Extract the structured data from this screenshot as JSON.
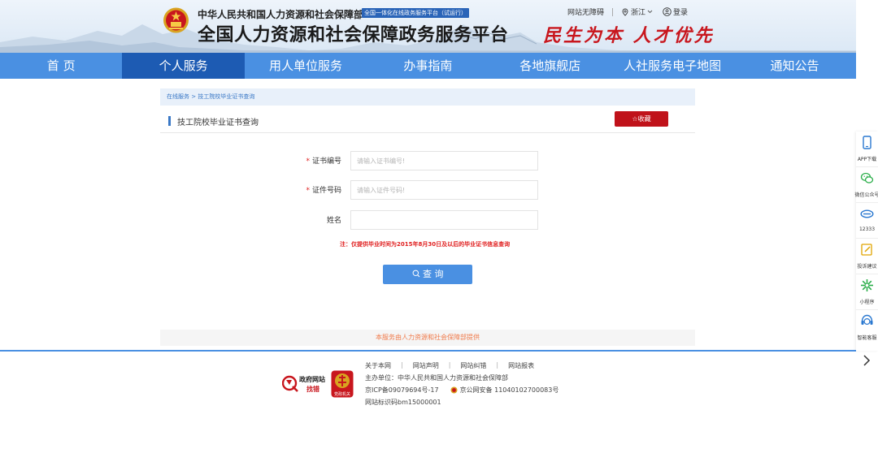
{
  "header": {
    "org_name": "中华人民共和国人力资源和社会保障部",
    "badge": "全国一体化在线政务服务平台（试运行）",
    "platform_title": "全国人力资源和社会保障政务服务平台",
    "slogan": "民生为本 人才优先",
    "accessibility_link": "网站无障碍",
    "location": "浙江",
    "login": "登录"
  },
  "nav": {
    "items": [
      {
        "label": "首 页"
      },
      {
        "label": "个人服务"
      },
      {
        "label": "用人单位服务"
      },
      {
        "label": "办事指南"
      },
      {
        "label": "各地旗舰店"
      },
      {
        "label": "人社服务电子地图"
      },
      {
        "label": "通知公告"
      }
    ],
    "active_index": 1
  },
  "breadcrumb": "在线服务 > 技工院校毕业证书查询",
  "section": {
    "title": "技工院校毕业证书查询",
    "favorite_label": "☆收藏"
  },
  "form": {
    "cert_no": {
      "label": "证书编号",
      "placeholder": "请输入证书编号!",
      "value": ""
    },
    "id_no": {
      "label": "证件号码",
      "placeholder": "请输入证件号码!",
      "value": ""
    },
    "name": {
      "label": "姓名",
      "placeholder": "",
      "value": ""
    },
    "required_mark": "*",
    "note": "注：仅提供毕业时间为2015年8月30日及以后的毕业证书信息查询",
    "query_label": "查 询"
  },
  "service_note": "本服务由人力资源和社会保障部提供",
  "footer": {
    "links": [
      "关于本网",
      "网站声明",
      "网站纠错",
      "网站报表"
    ],
    "sponsor": "主办单位：中华人民共和国人力资源和社会保障部",
    "icp": "京ICP备09079694号-17",
    "police": "京公网安备 11040102700083号",
    "site_id": "网站标识码bm15000001",
    "gov_logo_text_1": "政府网站",
    "gov_logo_text_2": "找错",
    "party_logo_text": "党政机关"
  },
  "sidebar": {
    "items": [
      {
        "label": "APP下载",
        "icon": "phone-icon"
      },
      {
        "label": "微信公众号",
        "icon": "wechat-icon"
      },
      {
        "label": "12333",
        "icon": "hotline-12333-icon"
      },
      {
        "label": "投诉建议",
        "icon": "edit-icon"
      },
      {
        "label": "小程序",
        "icon": "mini-program-icon"
      },
      {
        "label": "智能客服",
        "icon": "customer-service-icon"
      }
    ]
  },
  "colors": {
    "nav_bg": "#4a90e2",
    "nav_active": "#1d5bb3",
    "favorite_btn": "#c0121a",
    "required": "#e02020",
    "service_note": "#f07a4a"
  }
}
